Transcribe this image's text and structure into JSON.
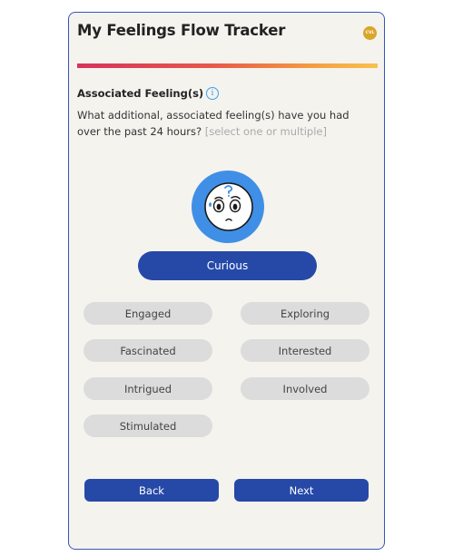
{
  "header": {
    "title": "My Feelings Flow Tracker",
    "badge": "CVL",
    "progress_fraction": 1.0
  },
  "section": {
    "title": "Associated Feeling(s)",
    "info_icon": "i",
    "question": "What additional, associated feeling(s) have you had over the past 24 hours?",
    "hint": "[select one or multiple]"
  },
  "face": {
    "icon": "curious-face-icon"
  },
  "selected_feeling": "Curious",
  "feelings": [
    "Engaged",
    "Exploring",
    "Fascinated",
    "Interested",
    "Intrigued",
    "Involved",
    "Stimulated"
  ],
  "nav": {
    "back_label": "Back",
    "next_label": "Next"
  }
}
